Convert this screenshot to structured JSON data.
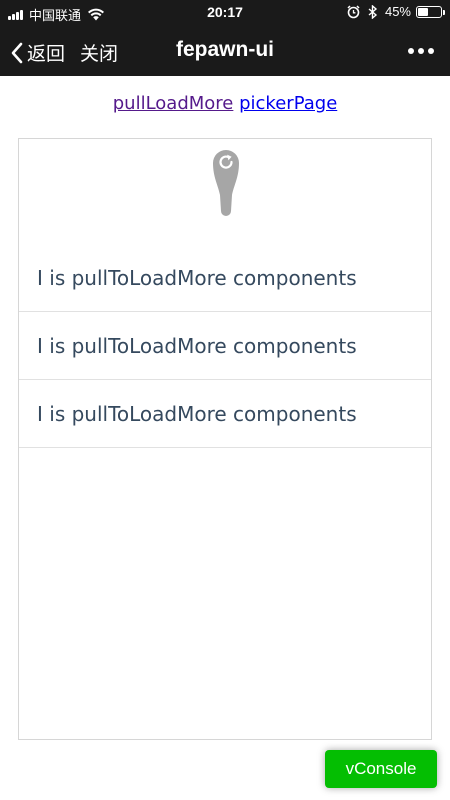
{
  "status_bar": {
    "carrier": "中国联通",
    "time": "20:17",
    "battery_text": "45%",
    "battery_level": 0.45
  },
  "nav": {
    "back_label": "返回",
    "close_label": "关闭",
    "title": "fepawn-ui"
  },
  "links": [
    {
      "label": "pullLoadMore"
    },
    {
      "label": "pickerPage"
    }
  ],
  "list_items": [
    "I is pullToLoadMore components",
    "I is pullToLoadMore components",
    "I is pullToLoadMore components"
  ],
  "vconsole": {
    "label": "vConsole"
  },
  "colors": {
    "bar_bg": "#1a1a1a",
    "vconsole_green": "#04be02",
    "list_text": "#35495e",
    "indicator_gray": "#a6a6a6"
  }
}
